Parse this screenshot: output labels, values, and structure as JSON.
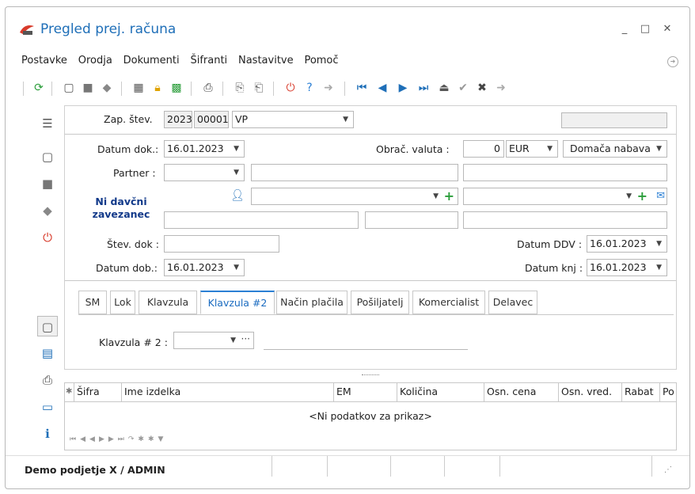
{
  "window": {
    "title": "Pregled prej. računa"
  },
  "menu": [
    "Postavke",
    "Orodja",
    "Dokumenti",
    "Šifranti",
    "Nastavitve",
    "Pomoč"
  ],
  "header": {
    "zap_label": "Zap. štev.",
    "year": "2023",
    "number": "00001",
    "doc_type": "VP"
  },
  "form": {
    "datum_dok_label": "Datum dok.:",
    "datum_dok": "16.01.2023",
    "obrac_valuta_label": "Obrač. valuta :",
    "valuta_amount": "0",
    "valuta": "EUR",
    "nabava": "Domača nabava",
    "partner_label": "Partner :",
    "ni_davcni": "Ni davčni zavezanec",
    "stev_dok_label": "Štev. dok :",
    "datum_ddv_label": "Datum DDV :",
    "datum_ddv": "16.01.2023",
    "datum_dob_label": "Datum dob.:",
    "datum_dob": "16.01.2023",
    "datum_knj_label": "Datum knj :",
    "datum_knj": "16.01.2023"
  },
  "tabs": [
    "SM",
    "Lok",
    "Klavzula",
    "Klavzula #2",
    "Način plačila",
    "Pošiljatelj",
    "Komercialist",
    "Delavec"
  ],
  "active_tab": "Klavzula #2",
  "klavzula": {
    "label": "Klavzula # 2 :"
  },
  "grid": {
    "columns": [
      "Šifra",
      "Ime izdelka",
      "EM",
      "Količina",
      "Osn. cena",
      "Osn. vred.",
      "Rabat",
      "Po"
    ],
    "empty_text": "<Ni podatkov za prikaz>"
  },
  "status": {
    "company": "Demo podjetje X / ADMIN"
  },
  "colors": {
    "accent": "#1f6fb8",
    "power": "#d83b2b",
    "green": "#2a9d3a"
  }
}
